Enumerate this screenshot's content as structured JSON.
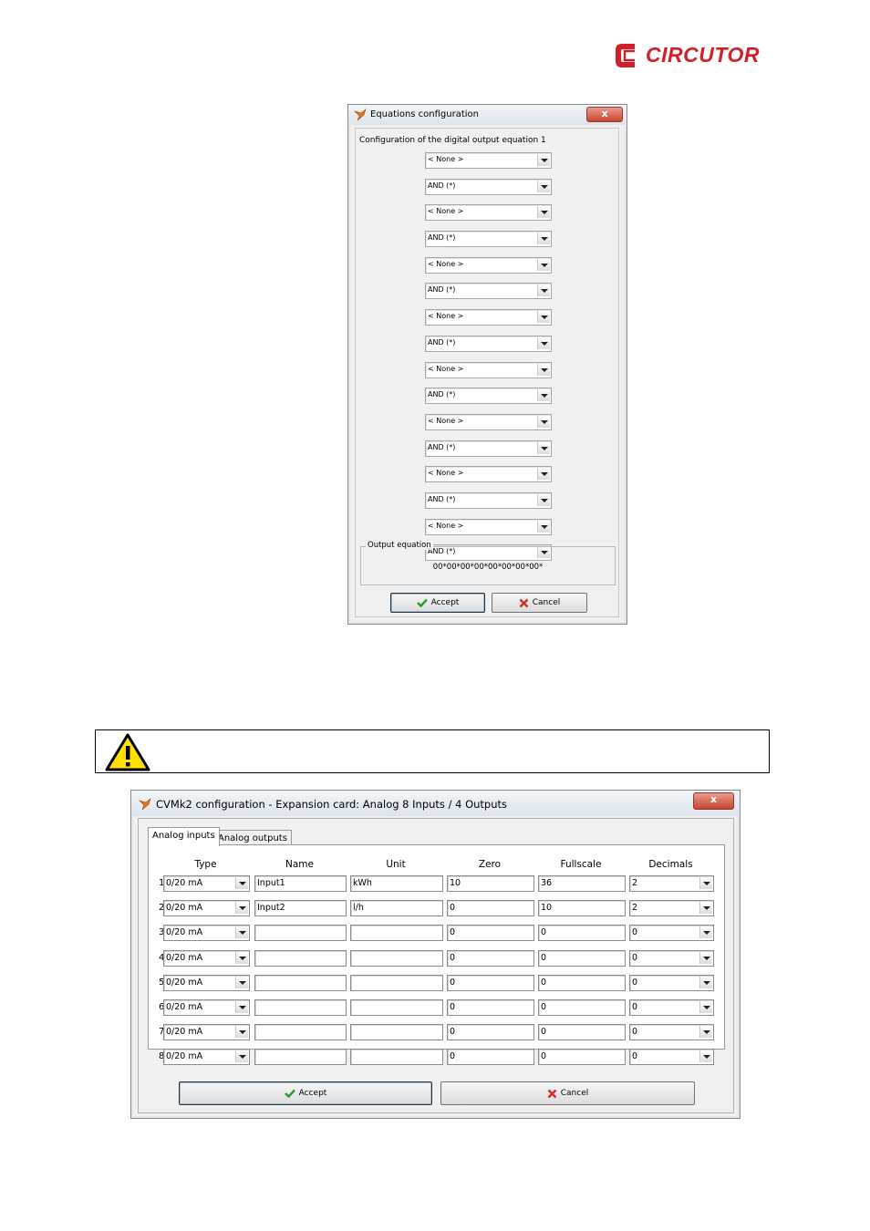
{
  "logo": {
    "text": "CIRCUTOR",
    "color": "#d0202a"
  },
  "equations_dialog": {
    "title": "Equations configuration",
    "heading": "Configuration of the digital output equation 1",
    "combos": [
      "< None >",
      "AND (*)",
      "< None >",
      "AND (*)",
      "< None >",
      "AND (*)",
      "< None >",
      "AND (*)",
      "< None >",
      "AND (*)",
      "< None >",
      "AND (*)",
      "< None >",
      "AND (*)",
      "< None >",
      "AND (*)"
    ],
    "output_group_label": "Output equation",
    "output_value": "00*00*00*00*00*00*00*00*",
    "accept_label": "Accept",
    "cancel_label": "Cancel",
    "close_label": "x"
  },
  "cvmk2_dialog": {
    "title": "CVMk2 configuration - Expansion card: Analog 8 Inputs / 4 Outputs",
    "close_label": "x",
    "tabs": [
      "Analog inputs",
      "Analog outputs"
    ],
    "columns": [
      "Type",
      "Name",
      "Unit",
      "Zero",
      "Fullscale",
      "Decimals"
    ],
    "rows": [
      {
        "n": "1",
        "type": "0/20 mA",
        "name": "Input1",
        "unit": "kWh",
        "zero": "10",
        "fullscale": "36",
        "decimals": "2"
      },
      {
        "n": "2",
        "type": "0/20 mA",
        "name": "Input2",
        "unit": "l/h",
        "zero": "0",
        "fullscale": "10",
        "decimals": "2"
      },
      {
        "n": "3",
        "type": "0/20 mA",
        "name": "",
        "unit": "",
        "zero": "0",
        "fullscale": "0",
        "decimals": "0"
      },
      {
        "n": "4",
        "type": "0/20 mA",
        "name": "",
        "unit": "",
        "zero": "0",
        "fullscale": "0",
        "decimals": "0"
      },
      {
        "n": "5",
        "type": "0/20 mA",
        "name": "",
        "unit": "",
        "zero": "0",
        "fullscale": "0",
        "decimals": "0"
      },
      {
        "n": "6",
        "type": "0/20 mA",
        "name": "",
        "unit": "",
        "zero": "0",
        "fullscale": "0",
        "decimals": "0"
      },
      {
        "n": "7",
        "type": "0/20 mA",
        "name": "",
        "unit": "",
        "zero": "0",
        "fullscale": "0",
        "decimals": "0"
      },
      {
        "n": "8",
        "type": "0/20 mA",
        "name": "",
        "unit": "",
        "zero": "0",
        "fullscale": "0",
        "decimals": "0"
      }
    ],
    "accept_label": "Accept",
    "cancel_label": "Cancel"
  }
}
